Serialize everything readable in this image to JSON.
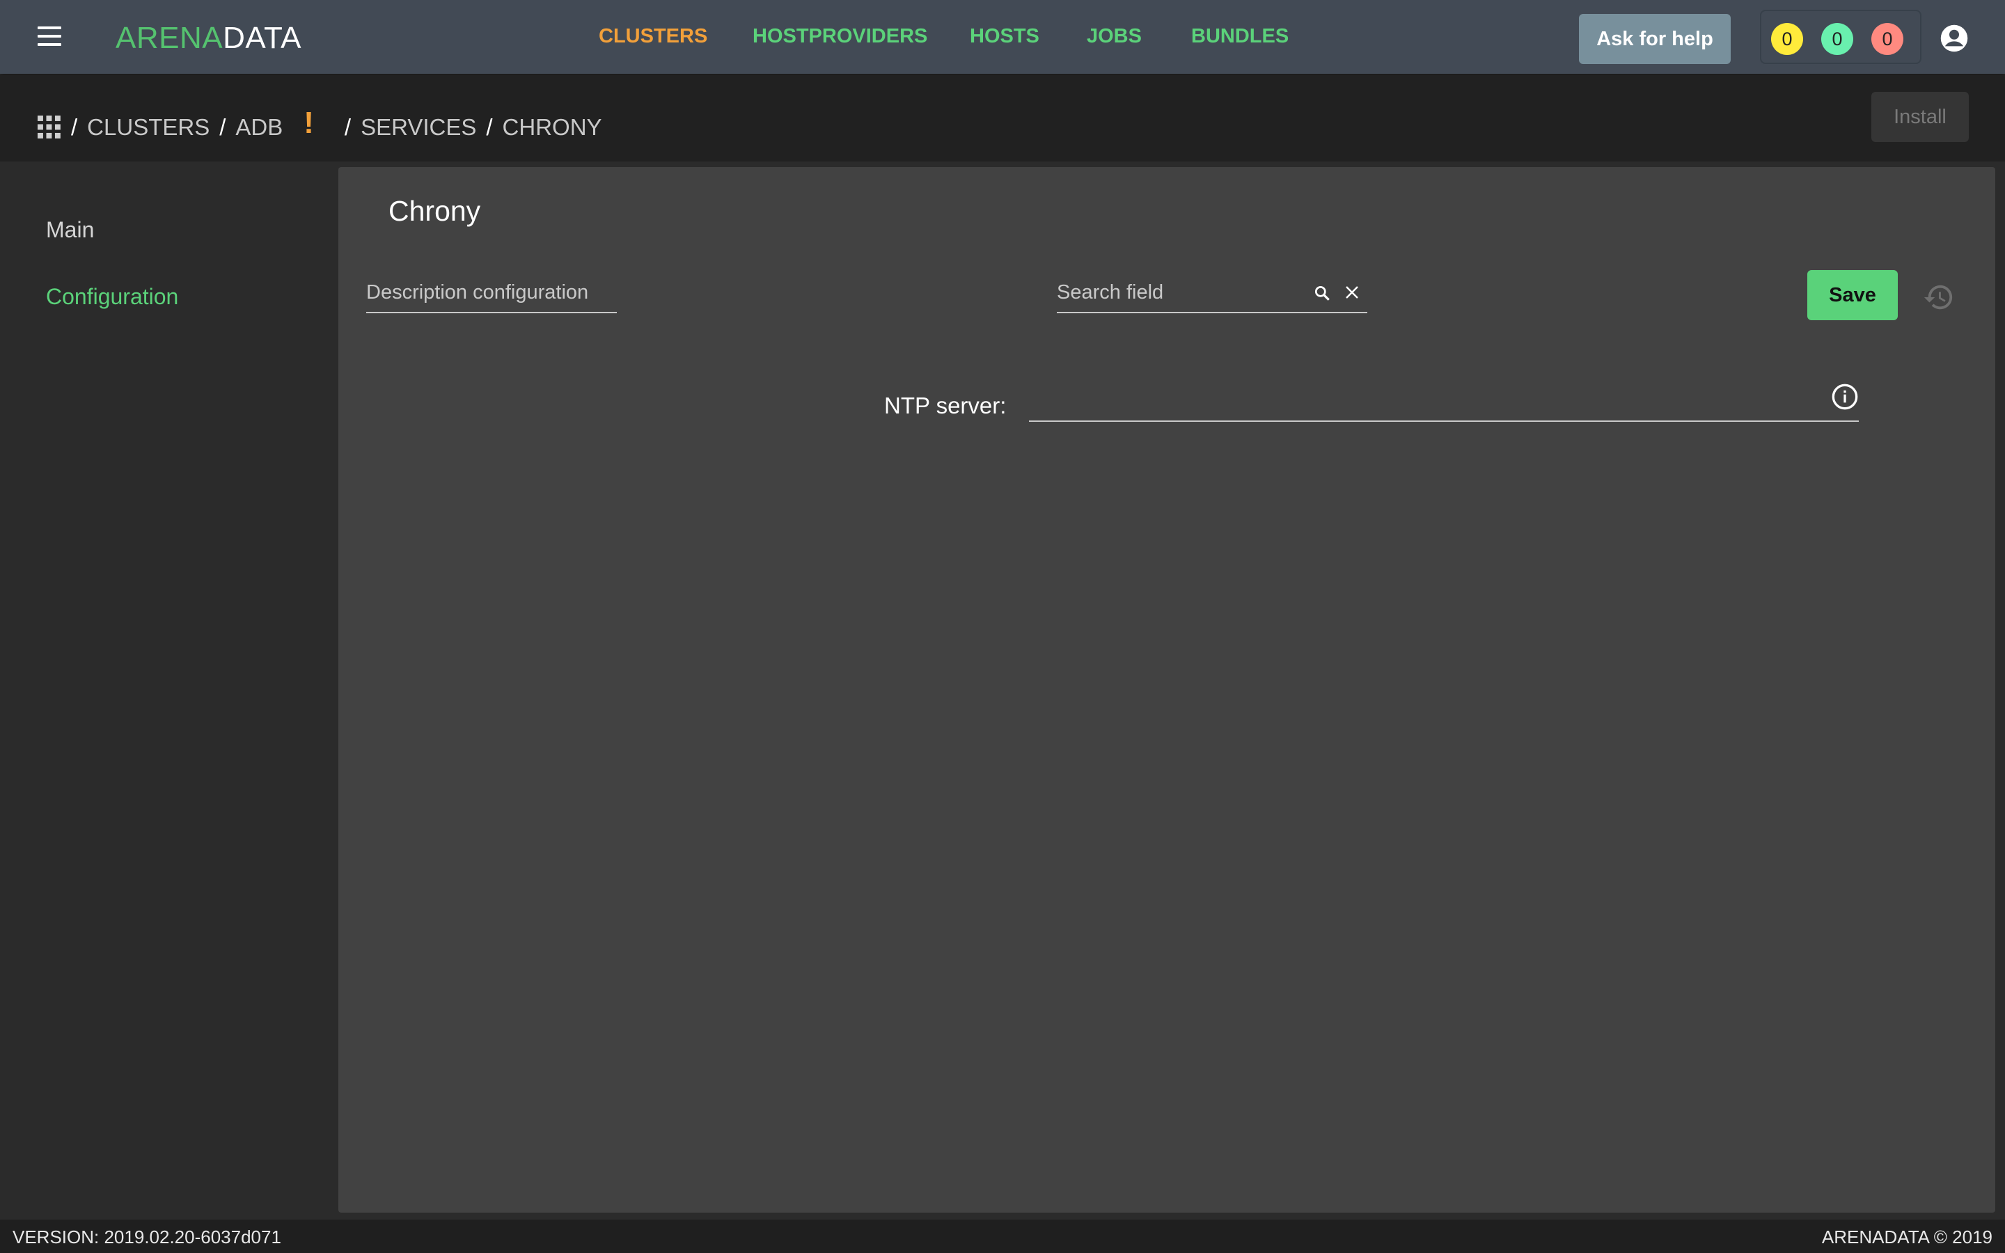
{
  "header": {
    "logo_part1": "ARENA",
    "logo_part2": "DATA",
    "nav": [
      "CLUSTERS",
      "HOSTPROVIDERS",
      "HOSTS",
      "JOBS",
      "BUNDLES"
    ],
    "active_nav": "CLUSTERS",
    "help_label": "Ask for help",
    "counters": [
      {
        "value": "0",
        "color": "#ffeb3b"
      },
      {
        "value": "0",
        "color": "#69f0ae"
      },
      {
        "value": "0",
        "color": "#ff8a80"
      }
    ]
  },
  "breadcrumb": {
    "items": [
      "CLUSTERS",
      "ADB",
      "SERVICES",
      "CHRONY"
    ],
    "warning_mark": "!",
    "separator": "/"
  },
  "toolbar": {
    "install_label": "Install"
  },
  "sidebar": {
    "items": [
      {
        "label": "Main",
        "active": false
      },
      {
        "label": "Configuration",
        "active": true
      }
    ]
  },
  "main": {
    "title": "Chrony",
    "description_placeholder": "Description configuration",
    "search_placeholder": "Search field",
    "save_label": "Save",
    "fields": [
      {
        "label": "NTP server:",
        "value": ""
      }
    ]
  },
  "footer": {
    "version": "VERSION: 2019.02.20-6037d071",
    "copyright": "ARENADATA © 2019"
  },
  "colors": {
    "accent_green": "#5ad27a",
    "accent_orange": "#f2a03a",
    "topbar": "#424a55"
  }
}
